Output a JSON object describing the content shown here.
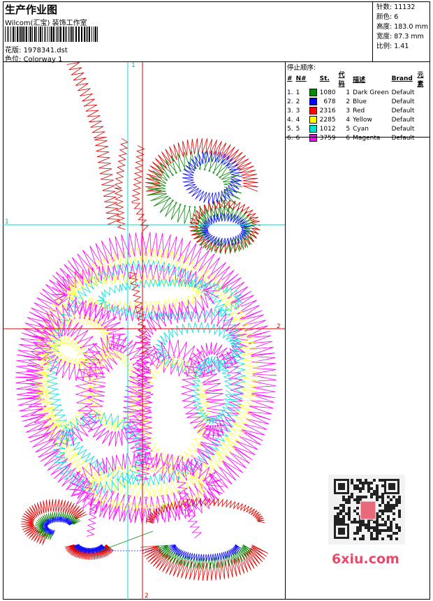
{
  "header": {
    "title": "生产作业图",
    "company": "Wilcom(汇宝) 装饰工作室",
    "file_label": "花版:",
    "file_value": "1978341.dst",
    "colorway_label": "色位:",
    "colorway_value": "Colorway 1"
  },
  "stats": {
    "stitches": "针数: 11132",
    "colors": "颜色: 6",
    "height": "高度: 183.0 mm",
    "width": "宽度: 87.3 mm",
    "scale": "比例: 1.41"
  },
  "stop_sequence": {
    "title": "停止顺序:",
    "headers": [
      "#",
      "N#",
      "St.",
      "代码",
      "描述",
      "Brand",
      "元素"
    ],
    "rows": [
      {
        "idx": "1.",
        "n": "1",
        "color": "#0a8a0a",
        "st": "1080",
        "code": "1",
        "desc": "Dark Green",
        "brand": "Default"
      },
      {
        "idx": "2.",
        "n": "2",
        "color": "#0000ff",
        "st": "678",
        "code": "2",
        "desc": "Blue",
        "brand": "Default"
      },
      {
        "idx": "3.",
        "n": "3",
        "color": "#ff0000",
        "st": "2316",
        "code": "3",
        "desc": "Red",
        "brand": "Default"
      },
      {
        "idx": "4.",
        "n": "4",
        "color": "#ffff00",
        "st": "2285",
        "code": "4",
        "desc": "Yellow",
        "brand": "Default"
      },
      {
        "idx": "5.",
        "n": "5",
        "color": "#00e0d0",
        "st": "1012",
        "code": "5",
        "desc": "Cyan",
        "brand": "Default"
      },
      {
        "idx": "6.",
        "n": "6",
        "color": "#ff00ff",
        "st": "3759",
        "code": "6",
        "desc": "Magenta",
        "brand": "Default"
      }
    ]
  },
  "canvas": {
    "axis_labels": {
      "v1": "1",
      "h1": "1",
      "h2": "2",
      "v2": "2"
    },
    "colors": {
      "cyan": "#00e0e0",
      "red": "#e00000",
      "magenta": "#ff00ff",
      "yellow": "#ffff40",
      "green": "#0a8a0a",
      "blue": "#1010ff"
    }
  },
  "watermark": {
    "text": "6xiu.com"
  }
}
